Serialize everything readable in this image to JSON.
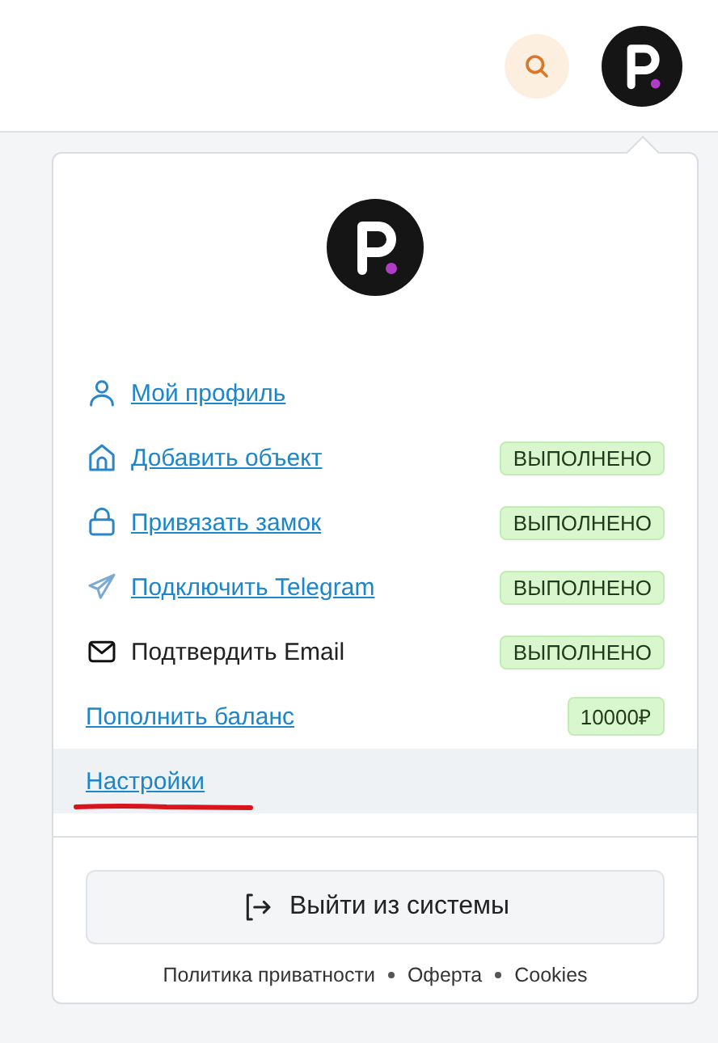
{
  "menu": {
    "items": [
      {
        "kind": "user",
        "label": "Мой профиль",
        "link": true,
        "selected": false,
        "marked": false
      },
      {
        "kind": "home",
        "label": "Добавить объект",
        "link": true,
        "badge": "ВЫПОЛНЕНО",
        "selected": false,
        "marked": false
      },
      {
        "kind": "lock",
        "label": "Привязать замок",
        "link": true,
        "badge": "ВЫПОЛНЕНО",
        "selected": false,
        "marked": false
      },
      {
        "kind": "telegram",
        "label": "Подключить Telegram",
        "link": true,
        "badge": "ВЫПОЛНЕНО",
        "selected": false,
        "marked": false
      },
      {
        "kind": "email",
        "label": "Подтвердить Email",
        "link": false,
        "badge": "ВЫПОЛНЕНО",
        "selected": false,
        "marked": false
      },
      {
        "kind": "plain",
        "label": "Пополнить баланс",
        "link": true,
        "badge": "10000₽",
        "selected": false,
        "marked": false
      },
      {
        "kind": "plain",
        "label": "Настройки",
        "link": true,
        "selected": true,
        "marked": true
      }
    ]
  },
  "logout": {
    "label": "Выйти из системы"
  },
  "footer_links": [
    "Политика приватности",
    "Оферта",
    "Cookies"
  ]
}
